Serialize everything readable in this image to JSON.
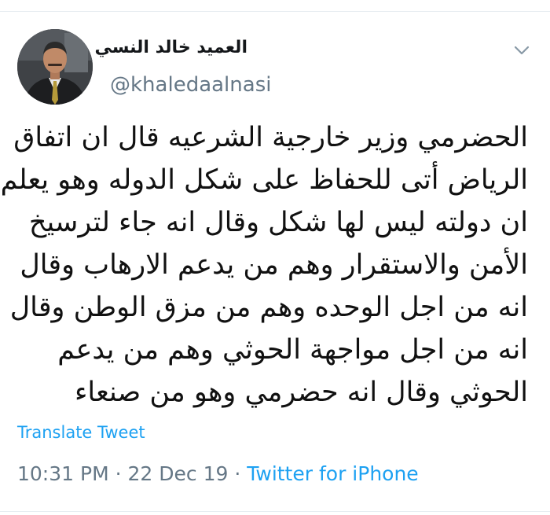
{
  "author": {
    "display_name": "العميد خالد النسي",
    "handle": "@khaledaalnasi"
  },
  "menu_icon": "chevron-down-icon",
  "tweet": {
    "lines": [
      "الحضرمي وزير خارجية الشرعيه قال ان اتفاق",
      "الرياض أتى للحفاظ على شكل الدوله وهو يعلم",
      "ان دولته ليس لها شكل وقال انه جاء لترسيخ",
      "الأمن والاستقرار وهم من يدعم الارهاب وقال",
      "انه من اجل الوحده وهم من مزق الوطن وقال",
      "انه من اجل مواجهة الحوثي وهم من يدعم",
      "الحوثي وقال انه حضرمي وهو من صنعاء"
    ]
  },
  "translate_label": "Translate Tweet",
  "meta": {
    "time": "10:31 PM",
    "separator": " · ",
    "date": "22 Dec 19",
    "client": "Twitter for iPhone"
  },
  "colors": {
    "link": "#1da1f2",
    "secondary_text": "#657786",
    "primary_text": "#14171a"
  }
}
